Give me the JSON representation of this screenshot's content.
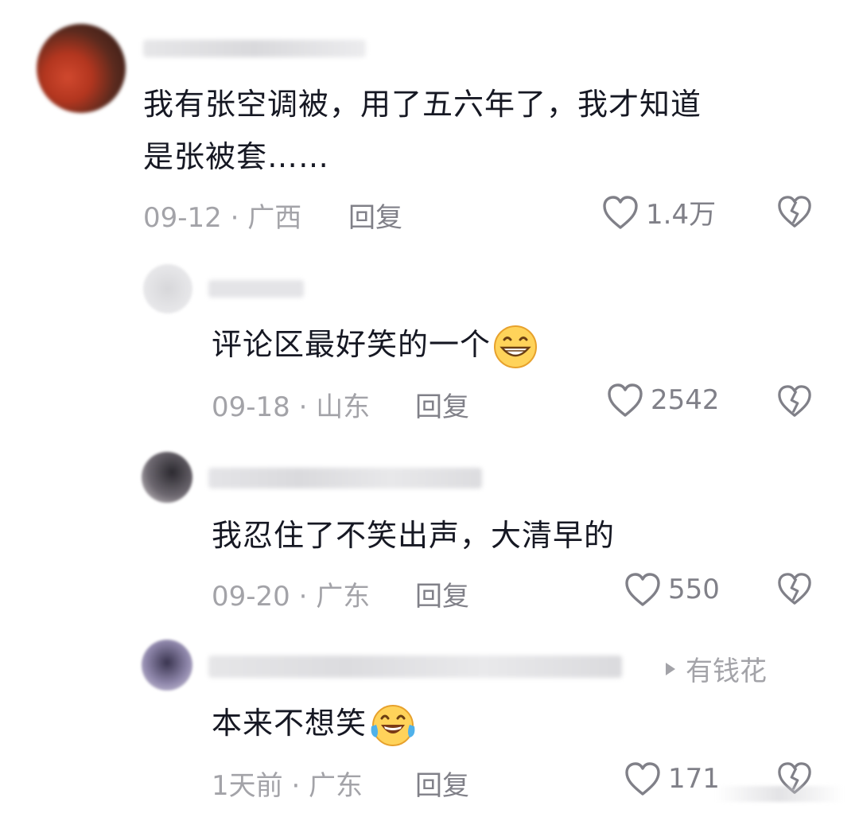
{
  "comments": [
    {
      "text_line1": "我有张空调被，用了五六年了，我才知道",
      "text_line2": "是张被套……",
      "date_location": "09-12 · 广西",
      "reply_label": "回复",
      "likes": "1.4万"
    },
    {
      "text": "评论区最好笑的一个",
      "emoji": "grinning-emoji",
      "date_location": "09-18 · 山东",
      "reply_label": "回复",
      "likes": "2542"
    },
    {
      "text": "我忍住了不笑出声，大清早的",
      "date_location": "09-20 · 广东",
      "reply_label": "回复",
      "likes": "550"
    },
    {
      "text": "本来不想笑",
      "emoji": "tears-of-joy-emoji",
      "reply_to": "有钱花",
      "date_location": "1天前 · 广东",
      "reply_label": "回复",
      "likes": "171"
    }
  ],
  "colors": {
    "text": "#161823",
    "meta": "#a3a3a8",
    "icon": "#808088",
    "background": "#ffffff"
  }
}
